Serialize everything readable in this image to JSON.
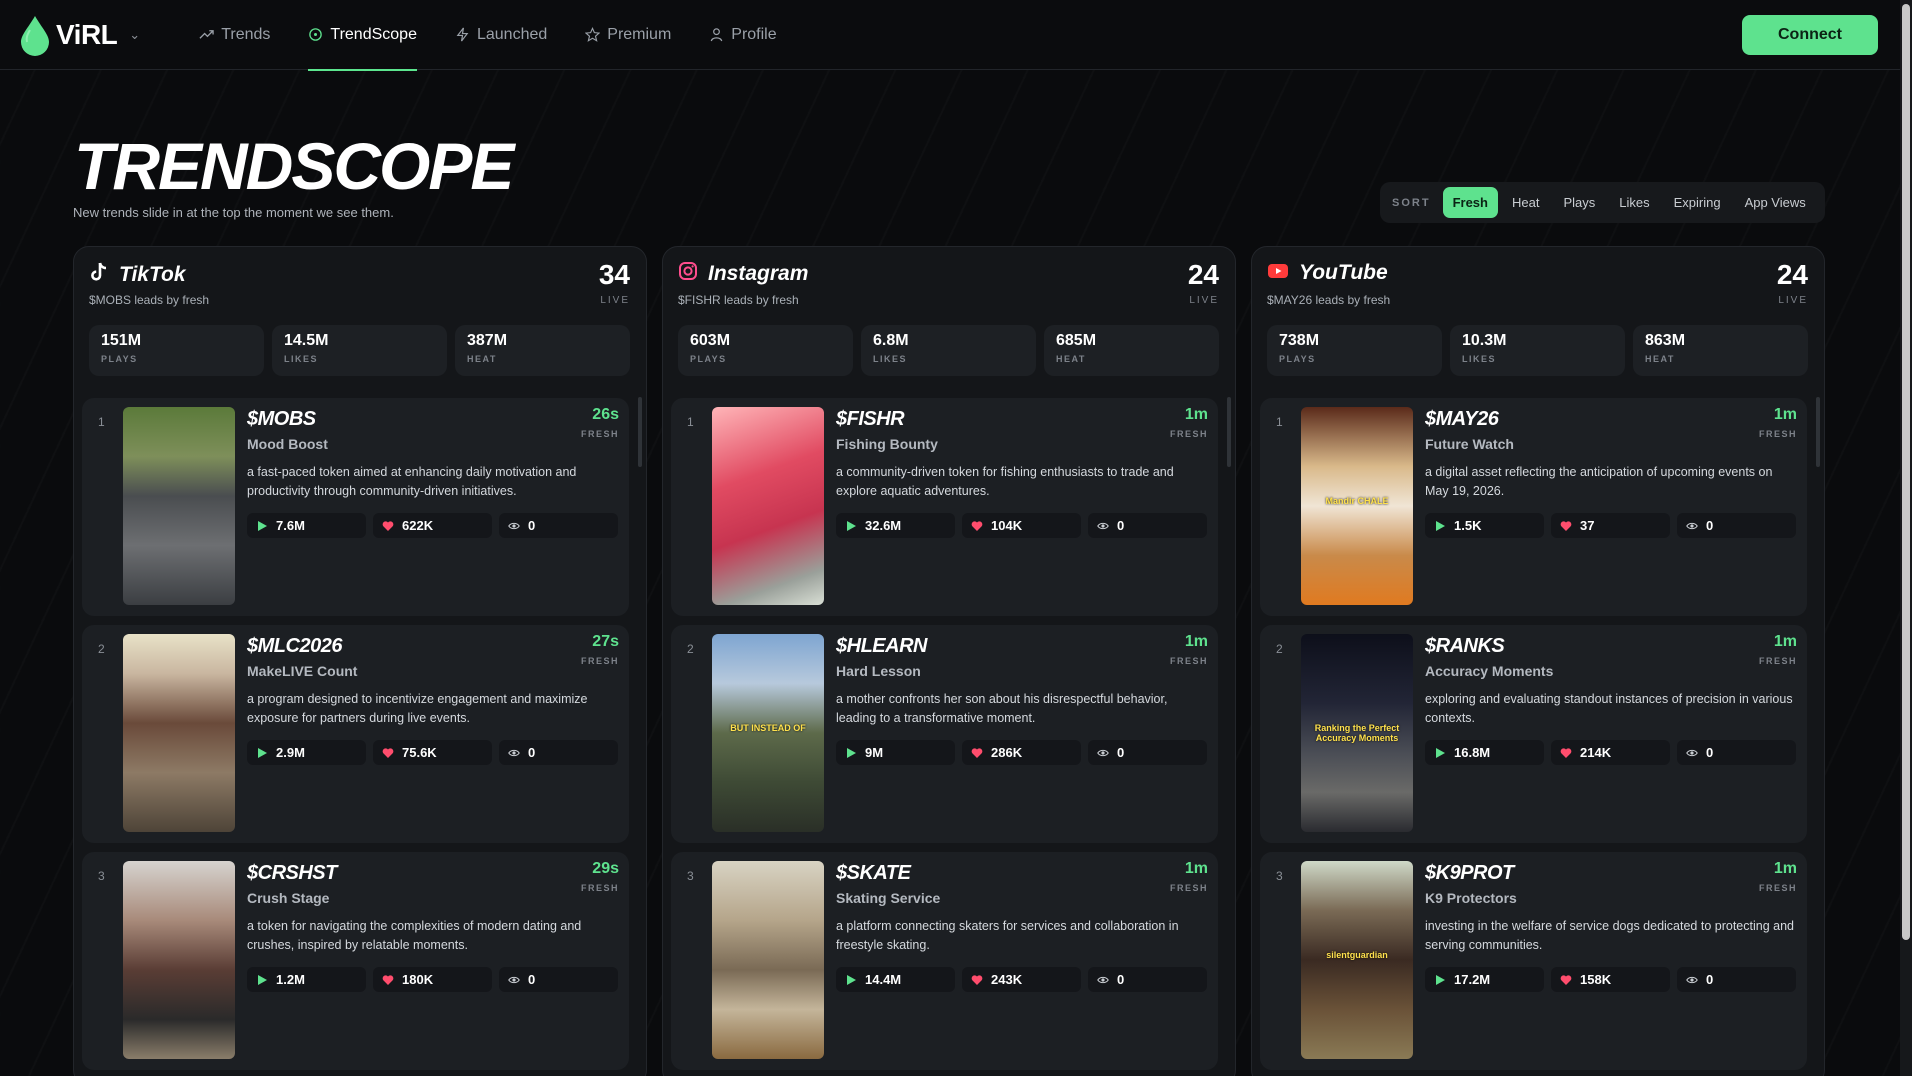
{
  "app": {
    "name": "ViRL"
  },
  "nav": {
    "items": [
      {
        "label": "Trends"
      },
      {
        "label": "TrendScope"
      },
      {
        "label": "Launched"
      },
      {
        "label": "Premium"
      },
      {
        "label": "Profile"
      }
    ],
    "connect_label": "Connect"
  },
  "header": {
    "title": "TRENDSCOPE",
    "subtitle": "New trends slide in at the top the moment we see them."
  },
  "sort": {
    "label": "SORT",
    "options": [
      "Fresh",
      "Heat",
      "Plays",
      "Likes",
      "Expiring",
      "App Views"
    ],
    "active": "Fresh"
  },
  "colors": {
    "accent": "#5ee28e",
    "heart": "#ff4d6d"
  },
  "columns": [
    {
      "platform": "TikTok",
      "icon": "tiktok-icon",
      "leader": "$MOBS leads by fresh",
      "count": "34",
      "live_label": "LIVE",
      "stats": [
        {
          "value": "151M",
          "label": "PLAYS"
        },
        {
          "value": "14.5M",
          "label": "LIKES"
        },
        {
          "value": "387M",
          "label": "HEAT"
        }
      ],
      "cards": [
        {
          "rank": "1",
          "ticker": "$MOBS",
          "name": "Mood Boost",
          "age": "26s",
          "fresh_label": "FRESH",
          "desc": "a fast-paced token aimed at enhancing daily motivation and productivity through community-driven initiatives.",
          "plays": "7.6M",
          "likes": "622K",
          "views": "0"
        },
        {
          "rank": "2",
          "ticker": "$MLC2026",
          "name": "MakeLIVE Count",
          "age": "27s",
          "fresh_label": "FRESH",
          "desc": "a program designed to incentivize engagement and maximize exposure for partners during live events.",
          "plays": "2.9M",
          "likes": "75.6K",
          "views": "0"
        },
        {
          "rank": "3",
          "ticker": "$CRSHST",
          "name": "Crush Stage",
          "age": "29s",
          "fresh_label": "FRESH",
          "desc": "a token for navigating the complexities of modern dating and crushes, inspired by relatable moments.",
          "plays": "1.2M",
          "likes": "180K",
          "views": "0"
        }
      ]
    },
    {
      "platform": "Instagram",
      "icon": "instagram-icon",
      "leader": "$FISHR leads by fresh",
      "count": "24",
      "live_label": "LIVE",
      "stats": [
        {
          "value": "603M",
          "label": "PLAYS"
        },
        {
          "value": "6.8M",
          "label": "LIKES"
        },
        {
          "value": "685M",
          "label": "HEAT"
        }
      ],
      "cards": [
        {
          "rank": "1",
          "ticker": "$FISHR",
          "name": "Fishing Bounty",
          "age": "1m",
          "fresh_label": "FRESH",
          "desc": "a community-driven token for fishing enthusiasts to trade and explore aquatic adventures.",
          "plays": "32.6M",
          "likes": "104K",
          "views": "0"
        },
        {
          "rank": "2",
          "ticker": "$HLEARN",
          "name": "Hard Lesson",
          "age": "1m",
          "fresh_label": "FRESH",
          "desc": "a mother confronts her son about his disrespectful behavior, leading to a transformative moment.",
          "plays": "9M",
          "likes": "286K",
          "views": "0",
          "thumb_caption": "BUT INSTEAD OF"
        },
        {
          "rank": "3",
          "ticker": "$SKATE",
          "name": "Skating Service",
          "age": "1m",
          "fresh_label": "FRESH",
          "desc": "a platform connecting skaters for services and collaboration in freestyle skating.",
          "plays": "14.4M",
          "likes": "243K",
          "views": "0"
        }
      ]
    },
    {
      "platform": "YouTube",
      "icon": "youtube-icon",
      "leader": "$MAY26 leads by fresh",
      "count": "24",
      "live_label": "LIVE",
      "stats": [
        {
          "value": "738M",
          "label": "PLAYS"
        },
        {
          "value": "10.3M",
          "label": "LIKES"
        },
        {
          "value": "863M",
          "label": "HEAT"
        }
      ],
      "cards": [
        {
          "rank": "1",
          "ticker": "$MAY26",
          "name": "Future Watch",
          "age": "1m",
          "fresh_label": "FRESH",
          "desc": "a digital asset reflecting the anticipation of upcoming events on May 19, 2026.",
          "plays": "1.5K",
          "likes": "37",
          "views": "0",
          "thumb_caption": "Mandir CHALE"
        },
        {
          "rank": "2",
          "ticker": "$RANKS",
          "name": "Accuracy Moments",
          "age": "1m",
          "fresh_label": "FRESH",
          "desc": "exploring and evaluating standout instances of precision in various contexts.",
          "plays": "16.8M",
          "likes": "214K",
          "views": "0",
          "thumb_caption": "Ranking the Perfect Accuracy Moments"
        },
        {
          "rank": "3",
          "ticker": "$K9PROT",
          "name": "K9 Protectors",
          "age": "1m",
          "fresh_label": "FRESH",
          "desc": "investing in the welfare of service dogs dedicated to protecting and serving communities.",
          "plays": "17.2M",
          "likes": "158K",
          "views": "0",
          "thumb_caption": "silentguardian"
        }
      ]
    }
  ]
}
